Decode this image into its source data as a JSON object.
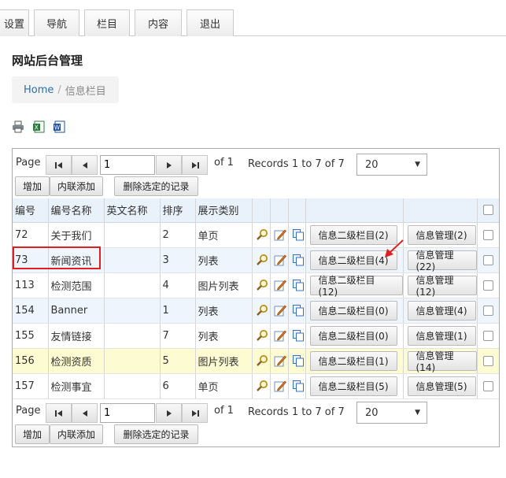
{
  "tabs": [
    "设置",
    "导航",
    "栏目",
    "内容",
    "退出"
  ],
  "page": {
    "title": "网站后台管理",
    "breadcrumb_home": "Home",
    "breadcrumb_sep": "/",
    "breadcrumb_current": "信息栏目"
  },
  "toolbar_icons": [
    "print-icon",
    "excel-icon",
    "word-icon"
  ],
  "pager": {
    "page_label": "Page",
    "page_value": "1",
    "of_label": "of 1",
    "records": "Records 1 to 7 of 7",
    "page_size": "20"
  },
  "actions": {
    "add": "增加",
    "inline_add": "内联添加",
    "delete_selected": "删除选定的记录"
  },
  "columns": [
    "编号",
    "编号名称",
    "英文名称",
    "排序",
    "展示类别"
  ],
  "rows": [
    {
      "id": "72",
      "name": "关于我们",
      "en": "",
      "order": "2",
      "type": "单页",
      "sub": "信息二级栏目(2)",
      "mgr": "信息管理(2)"
    },
    {
      "id": "73",
      "name": "新闻资讯",
      "en": "",
      "order": "3",
      "type": "列表",
      "sub": "信息二级栏目(4)",
      "mgr": "信息管理(22)"
    },
    {
      "id": "113",
      "name": "检测范围",
      "en": "",
      "order": "4",
      "type": "图片列表",
      "sub": "信息二级栏目(12)",
      "mgr": "信息管理(12)"
    },
    {
      "id": "154",
      "name": "Banner",
      "en": "",
      "order": "1",
      "type": "列表",
      "sub": "信息二级栏目(0)",
      "mgr": "信息管理(4)"
    },
    {
      "id": "155",
      "name": "友情链接",
      "en": "",
      "order": "7",
      "type": "列表",
      "sub": "信息二级栏目(0)",
      "mgr": "信息管理(1)"
    },
    {
      "id": "156",
      "name": "检测资质",
      "en": "",
      "order": "5",
      "type": "图片列表",
      "sub": "信息二级栏目(1)",
      "mgr": "信息管理(14)"
    },
    {
      "id": "157",
      "name": "检测事宜",
      "en": "",
      "order": "6",
      "type": "单页",
      "sub": "信息二级栏目(5)",
      "mgr": "信息管理(5)"
    }
  ],
  "colors": {
    "accent_link": "#2a6fb0",
    "highlight_row": "#fdfbd2",
    "alt_row": "#eef5fc",
    "annotation": "#e02020"
  }
}
